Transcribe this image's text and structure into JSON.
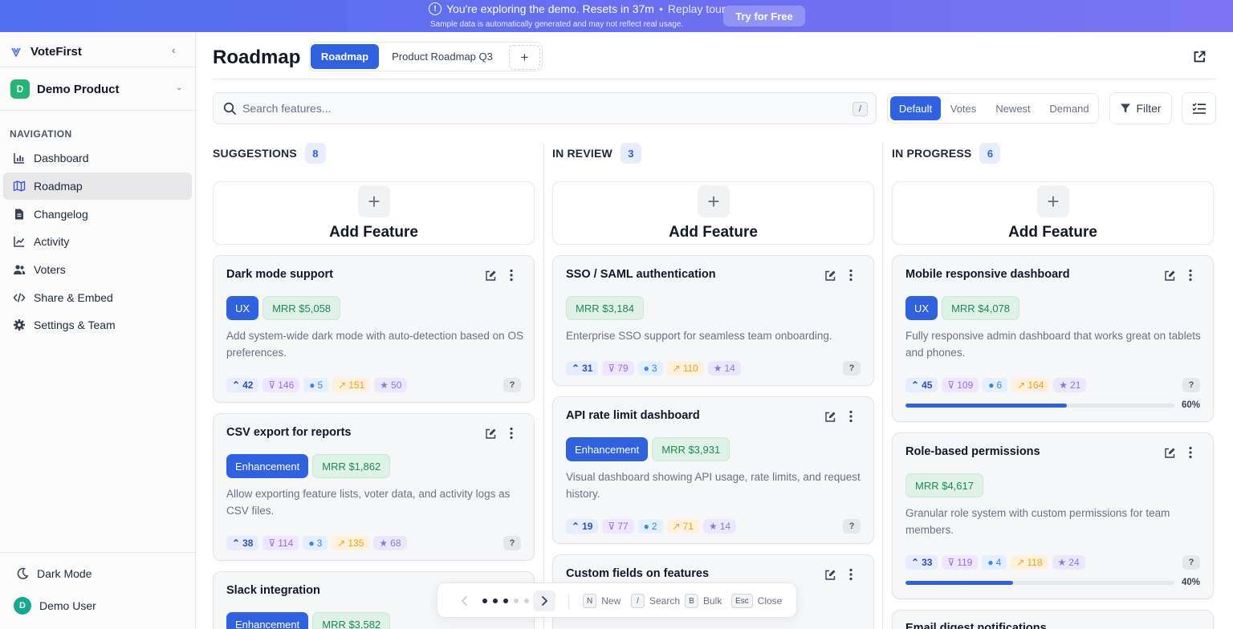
{
  "banner": {
    "message": "You're exploring the demo. Resets in 37m",
    "separator": " • ",
    "replay": "Replay tour",
    "subtext": "Sample data is automatically generated and may not reflect real usage.",
    "cta": "Try for Free"
  },
  "sidebar": {
    "brand": "VoteFirst",
    "product": {
      "initial": "D",
      "name": "Demo Product"
    },
    "nav_heading": "NAVIGATION",
    "items": [
      {
        "label": "Dashboard",
        "icon": "bar-chart-icon"
      },
      {
        "label": "Roadmap",
        "icon": "map-icon",
        "active": true
      },
      {
        "label": "Changelog",
        "icon": "document-icon"
      },
      {
        "label": "Activity",
        "icon": "line-chart-icon"
      },
      {
        "label": "Voters",
        "icon": "users-icon"
      },
      {
        "label": "Share & Embed",
        "icon": "code-icon"
      },
      {
        "label": "Settings & Team",
        "icon": "gear-icon"
      }
    ],
    "dark_mode": "Dark Mode",
    "user": {
      "initial": "D",
      "name": "Demo User"
    }
  },
  "header": {
    "title": "Roadmap",
    "tabs": [
      "Roadmap",
      "Product Roadmap Q3"
    ],
    "add_tab": "+"
  },
  "search": {
    "placeholder": "Search features...",
    "shortcut": "/"
  },
  "sort": {
    "options": [
      "Default",
      "Votes",
      "Newest",
      "Demand"
    ],
    "selected": "Default"
  },
  "filter_label": "Filter",
  "add_feature_label": "Add Feature",
  "columns": [
    {
      "title": "SUGGESTIONS",
      "count": "8",
      "cards": [
        {
          "title": "Dark mode support",
          "tags": [
            "UX"
          ],
          "mrr": "MRR $5,058",
          "description": "Add system-wide dark mode with auto-detection based on OS preferences.",
          "stats": {
            "votes": "42",
            "downvotes": "146",
            "comments": "5",
            "trend": "151",
            "stars": "50"
          }
        },
        {
          "title": "CSV export for reports",
          "tags": [
            "Enhancement"
          ],
          "mrr": "MRR $1,862",
          "description": "Allow exporting feature lists, voter data, and activity logs as CSV files.",
          "stats": {
            "votes": "38",
            "downvotes": "114",
            "comments": "3",
            "trend": "135",
            "stars": "68"
          }
        },
        {
          "title": "Slack integration",
          "tags": [
            "Enhancement"
          ],
          "mrr": "MRR $3,582"
        }
      ]
    },
    {
      "title": "IN REVIEW",
      "count": "3",
      "cards": [
        {
          "title": "SSO / SAML authentication",
          "tags": [],
          "mrr": "MRR $3,184",
          "description": "Enterprise SSO support for seamless team onboarding.",
          "stats": {
            "votes": "31",
            "downvotes": "79",
            "comments": "3",
            "trend": "110",
            "stars": "14"
          }
        },
        {
          "title": "API rate limit dashboard",
          "tags": [
            "Enhancement"
          ],
          "mrr": "MRR $3,931",
          "description": "Visual dashboard showing API usage, rate limits, and request history.",
          "stats": {
            "votes": "19",
            "downvotes": "77",
            "comments": "2",
            "trend": "71",
            "stars": "14"
          }
        },
        {
          "title": "Custom fields on features"
        }
      ]
    },
    {
      "title": "IN PROGRESS",
      "count": "6",
      "cards": [
        {
          "title": "Mobile responsive dashboard",
          "tags": [
            "UX"
          ],
          "mrr": "MRR $4,078",
          "description": "Fully responsive admin dashboard that works great on tablets and phones.",
          "stats": {
            "votes": "45",
            "downvotes": "109",
            "comments": "6",
            "trend": "164",
            "stars": "21"
          },
          "progress": 60,
          "progress_label": "60%"
        },
        {
          "title": "Role-based permissions",
          "tags": [],
          "mrr": "MRR $4,617",
          "description": "Granular role system with custom permissions for team members.",
          "stats": {
            "votes": "33",
            "downvotes": "119",
            "comments": "4",
            "trend": "118",
            "stars": "24"
          },
          "progress": 40,
          "progress_label": "40%"
        },
        {
          "title": "Email digest notifications"
        }
      ]
    }
  ],
  "help_label": "?",
  "pager": {
    "total_dots": 5,
    "active_dots": 3,
    "shortcuts": [
      {
        "key": "N",
        "label": "New"
      },
      {
        "key": "/",
        "label": "Search"
      },
      {
        "key": "B",
        "label": "Bulk"
      },
      {
        "key": "Esc",
        "label": "Close"
      }
    ]
  },
  "colors": {
    "accent": "#2f62e0",
    "banner": "#5b6ff0",
    "mrr": "#1f8a57",
    "avatar": "#22b573"
  }
}
